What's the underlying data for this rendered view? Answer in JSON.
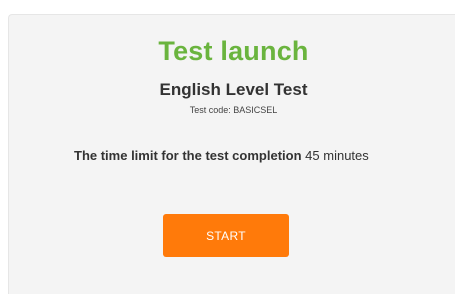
{
  "title": "Test launch",
  "test_name": "English Level Test",
  "test_code": "Test code: BASICSEL",
  "time_limit": {
    "label": "The time limit for the test completion",
    "value": "45",
    "unit": "minutes"
  },
  "start_button": "START",
  "colors": {
    "title": "#6ab43e",
    "button": "#ff7a0a",
    "panel": "#f4f4f4"
  }
}
